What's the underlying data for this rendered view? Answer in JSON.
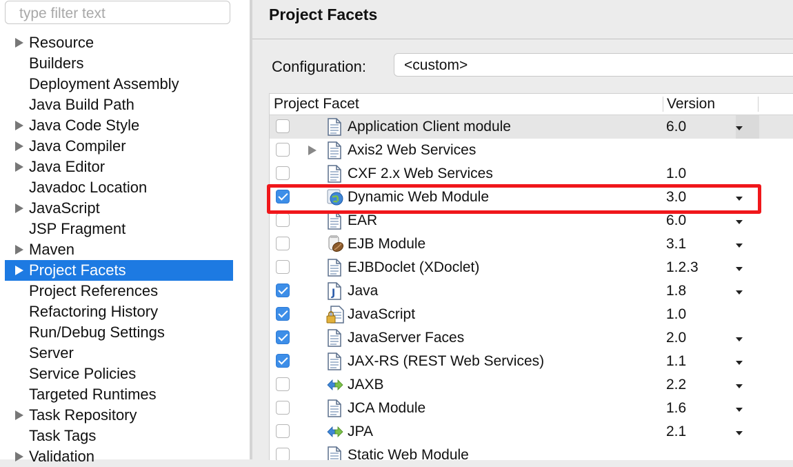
{
  "filter": {
    "placeholder": "type filter text"
  },
  "nav": [
    {
      "label": "Resource",
      "expandable": true
    },
    {
      "label": "Builders",
      "expandable": false
    },
    {
      "label": "Deployment Assembly",
      "expandable": false
    },
    {
      "label": "Java Build Path",
      "expandable": false
    },
    {
      "label": "Java Code Style",
      "expandable": true
    },
    {
      "label": "Java Compiler",
      "expandable": true
    },
    {
      "label": "Java Editor",
      "expandable": true
    },
    {
      "label": "Javadoc Location",
      "expandable": false
    },
    {
      "label": "JavaScript",
      "expandable": true
    },
    {
      "label": "JSP Fragment",
      "expandable": false
    },
    {
      "label": "Maven",
      "expandable": true
    },
    {
      "label": "Project Facets",
      "expandable": true,
      "selected": true
    },
    {
      "label": "Project References",
      "expandable": false
    },
    {
      "label": "Refactoring History",
      "expandable": false
    },
    {
      "label": "Run/Debug Settings",
      "expandable": false
    },
    {
      "label": "Server",
      "expandable": false
    },
    {
      "label": "Service Policies",
      "expandable": false
    },
    {
      "label": "Targeted Runtimes",
      "expandable": false
    },
    {
      "label": "Task Repository",
      "expandable": true
    },
    {
      "label": "Task Tags",
      "expandable": false
    },
    {
      "label": "Validation",
      "expandable": true
    }
  ],
  "main": {
    "title": "Project Facets",
    "configuration_label": "Configuration:",
    "configuration_value": "<custom>",
    "columns": {
      "facet": "Project Facet",
      "version": "Version"
    },
    "facets": [
      {
        "name": "Application Client module",
        "version": "6.0",
        "checked": false,
        "dropdown": true,
        "icon": "document-icon",
        "shaded": true
      },
      {
        "name": "Axis2 Web Services",
        "version": "",
        "checked": false,
        "dropdown": false,
        "icon": "document-icon",
        "expandable": true
      },
      {
        "name": "CXF 2.x Web Services",
        "version": "1.0",
        "checked": false,
        "dropdown": false,
        "icon": "document-icon"
      },
      {
        "name": "Dynamic Web Module",
        "version": "3.0",
        "checked": true,
        "dropdown": true,
        "icon": "globe-icon"
      },
      {
        "name": "EAR",
        "version": "6.0",
        "checked": false,
        "dropdown": true,
        "icon": "document-icon"
      },
      {
        "name": "EJB Module",
        "version": "3.1",
        "checked": false,
        "dropdown": true,
        "icon": "bean-jar-icon"
      },
      {
        "name": "EJBDoclet (XDoclet)",
        "version": "1.2.3",
        "checked": false,
        "dropdown": true,
        "icon": "document-icon"
      },
      {
        "name": "Java",
        "version": "1.8",
        "checked": true,
        "dropdown": true,
        "icon": "java-file-icon"
      },
      {
        "name": "JavaScript",
        "version": "1.0",
        "checked": true,
        "dropdown": false,
        "icon": "locked-document-icon"
      },
      {
        "name": "JavaServer Faces",
        "version": "2.0",
        "checked": true,
        "dropdown": true,
        "icon": "document-icon"
      },
      {
        "name": "JAX-RS (REST Web Services)",
        "version": "1.1",
        "checked": true,
        "dropdown": true,
        "icon": "document-icon"
      },
      {
        "name": "JAXB",
        "version": "2.2",
        "checked": false,
        "dropdown": true,
        "icon": "bidirectional-arrows-icon"
      },
      {
        "name": "JCA Module",
        "version": "1.6",
        "checked": false,
        "dropdown": true,
        "icon": "document-icon"
      },
      {
        "name": "JPA",
        "version": "2.1",
        "checked": false,
        "dropdown": true,
        "icon": "bidirectional-arrows-icon"
      },
      {
        "name": "Static Web Module",
        "version": "",
        "checked": false,
        "dropdown": false,
        "icon": "document-icon"
      }
    ]
  },
  "highlight_color": "#f0171b",
  "accent_color": "#1d7ae2"
}
